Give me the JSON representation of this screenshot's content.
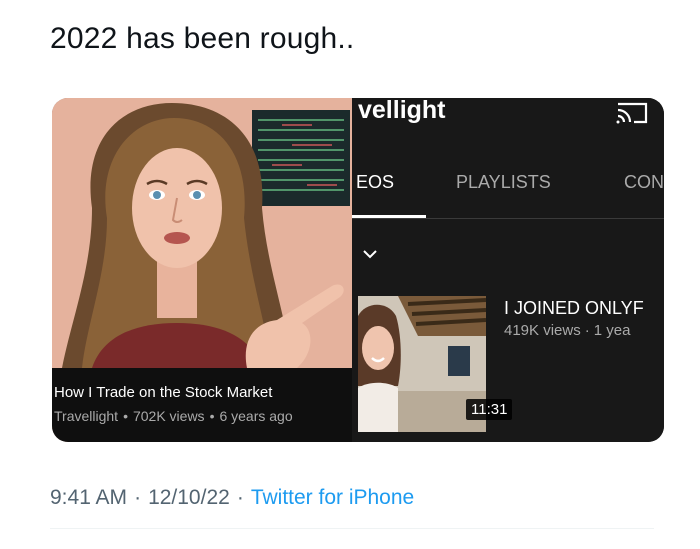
{
  "tweet": {
    "text": "2022 has been rough..",
    "time": "9:41 AM",
    "date": "12/10/22",
    "source": "Twitter for iPhone"
  },
  "left_video": {
    "title": "How I Trade on the Stock Market",
    "channel": "Travellight",
    "views": "702K views",
    "age": "6 years ago"
  },
  "channel_page": {
    "name": "vellight",
    "tabs": [
      "EOS",
      "PLAYLISTS",
      "CON"
    ],
    "active_tab": "EOS",
    "video": {
      "title": "I JOINED ONLYF",
      "views": "419K views",
      "age": "1 yea",
      "duration": "11:31"
    }
  },
  "colors": {
    "dark_bg": "#181818",
    "twitter_blue": "#1d9bf0",
    "meta_grey": "#536471"
  }
}
